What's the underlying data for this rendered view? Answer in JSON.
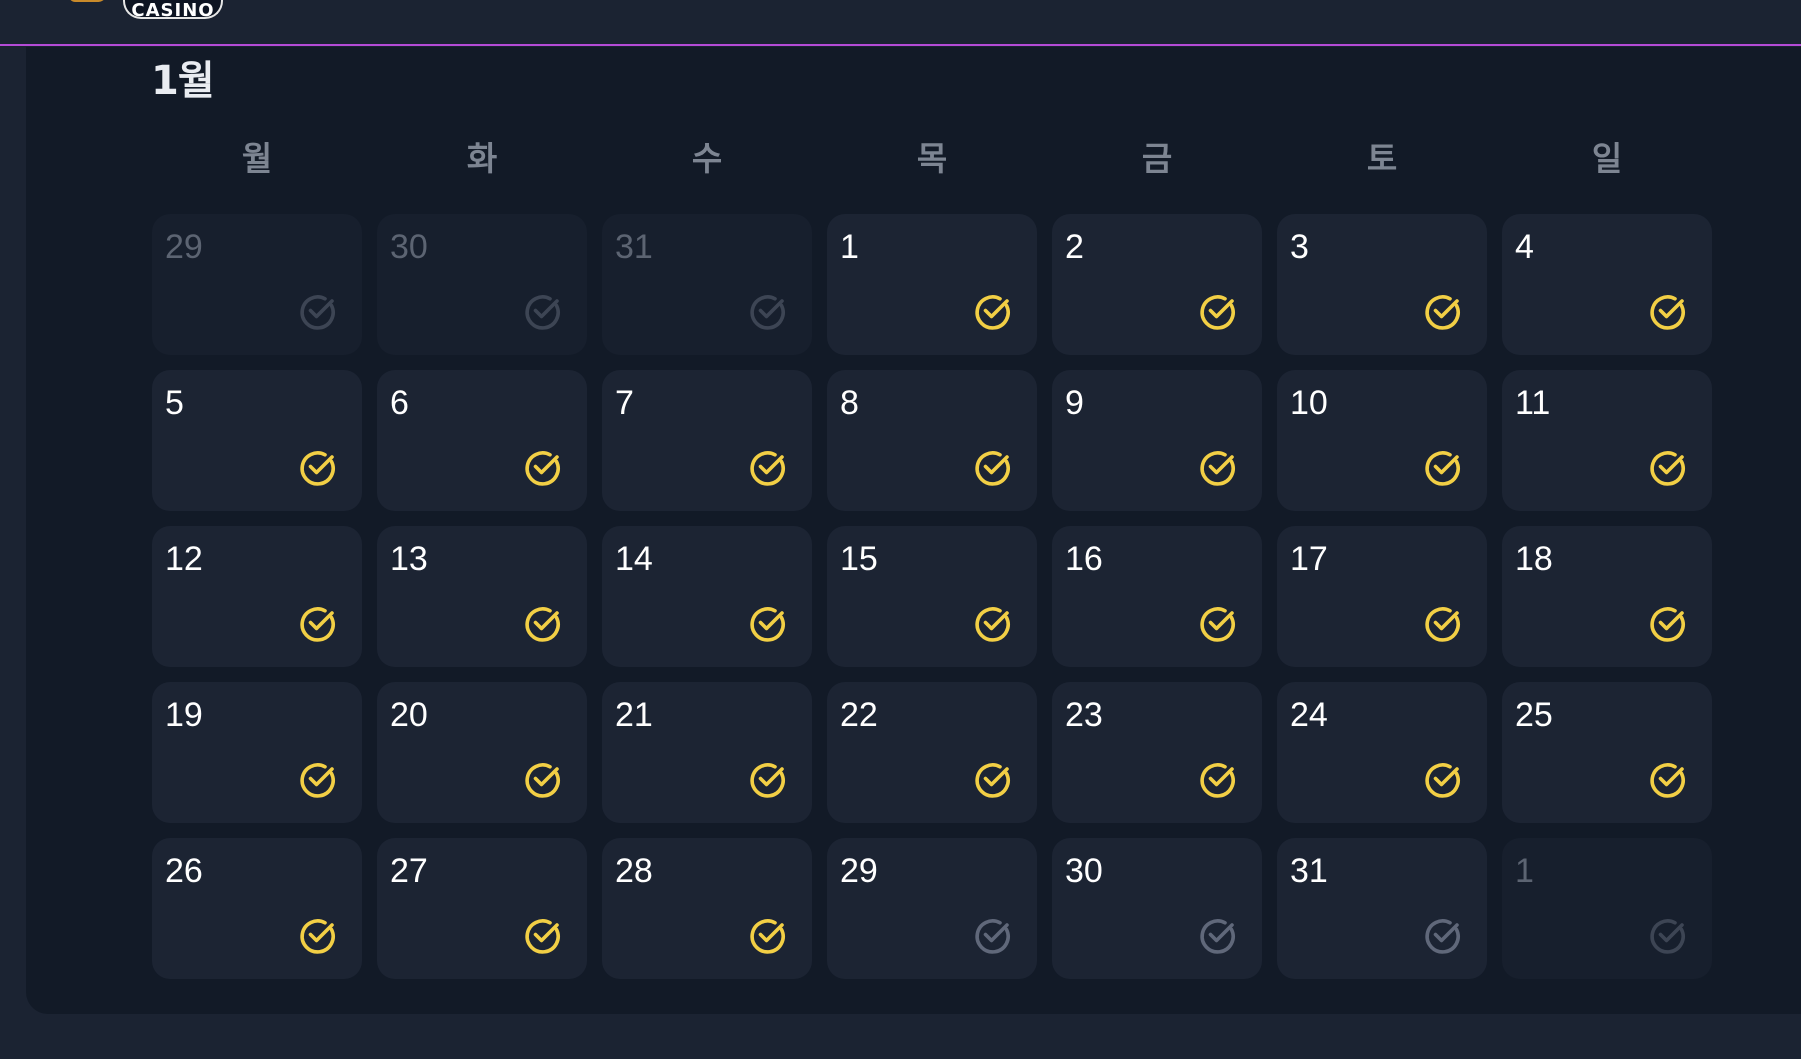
{
  "header": {
    "logo_text": "CASINO"
  },
  "calendar": {
    "month_title": "1월",
    "weekdays": [
      "월",
      "화",
      "수",
      "목",
      "금",
      "토",
      "일"
    ],
    "colors": {
      "checked": "#f2cf45",
      "unchecked": "#60687a",
      "outside_month": "#3d4554",
      "accent_line": "#b44bd6"
    },
    "days": [
      {
        "label": "29",
        "in_month": false,
        "checked": false
      },
      {
        "label": "30",
        "in_month": false,
        "checked": false
      },
      {
        "label": "31",
        "in_month": false,
        "checked": false
      },
      {
        "label": "1",
        "in_month": true,
        "checked": true
      },
      {
        "label": "2",
        "in_month": true,
        "checked": true
      },
      {
        "label": "3",
        "in_month": true,
        "checked": true
      },
      {
        "label": "4",
        "in_month": true,
        "checked": true
      },
      {
        "label": "5",
        "in_month": true,
        "checked": true
      },
      {
        "label": "6",
        "in_month": true,
        "checked": true
      },
      {
        "label": "7",
        "in_month": true,
        "checked": true
      },
      {
        "label": "8",
        "in_month": true,
        "checked": true
      },
      {
        "label": "9",
        "in_month": true,
        "checked": true
      },
      {
        "label": "10",
        "in_month": true,
        "checked": true
      },
      {
        "label": "11",
        "in_month": true,
        "checked": true
      },
      {
        "label": "12",
        "in_month": true,
        "checked": true
      },
      {
        "label": "13",
        "in_month": true,
        "checked": true
      },
      {
        "label": "14",
        "in_month": true,
        "checked": true
      },
      {
        "label": "15",
        "in_month": true,
        "checked": true
      },
      {
        "label": "16",
        "in_month": true,
        "checked": true
      },
      {
        "label": "17",
        "in_month": true,
        "checked": true
      },
      {
        "label": "18",
        "in_month": true,
        "checked": true
      },
      {
        "label": "19",
        "in_month": true,
        "checked": true
      },
      {
        "label": "20",
        "in_month": true,
        "checked": true
      },
      {
        "label": "21",
        "in_month": true,
        "checked": true
      },
      {
        "label": "22",
        "in_month": true,
        "checked": true
      },
      {
        "label": "23",
        "in_month": true,
        "checked": true
      },
      {
        "label": "24",
        "in_month": true,
        "checked": true
      },
      {
        "label": "25",
        "in_month": true,
        "checked": true
      },
      {
        "label": "26",
        "in_month": true,
        "checked": true
      },
      {
        "label": "27",
        "in_month": true,
        "checked": true
      },
      {
        "label": "28",
        "in_month": true,
        "checked": true
      },
      {
        "label": "29",
        "in_month": true,
        "checked": false
      },
      {
        "label": "30",
        "in_month": true,
        "checked": false
      },
      {
        "label": "31",
        "in_month": true,
        "checked": false
      },
      {
        "label": "1",
        "in_month": false,
        "checked": false
      }
    ]
  }
}
